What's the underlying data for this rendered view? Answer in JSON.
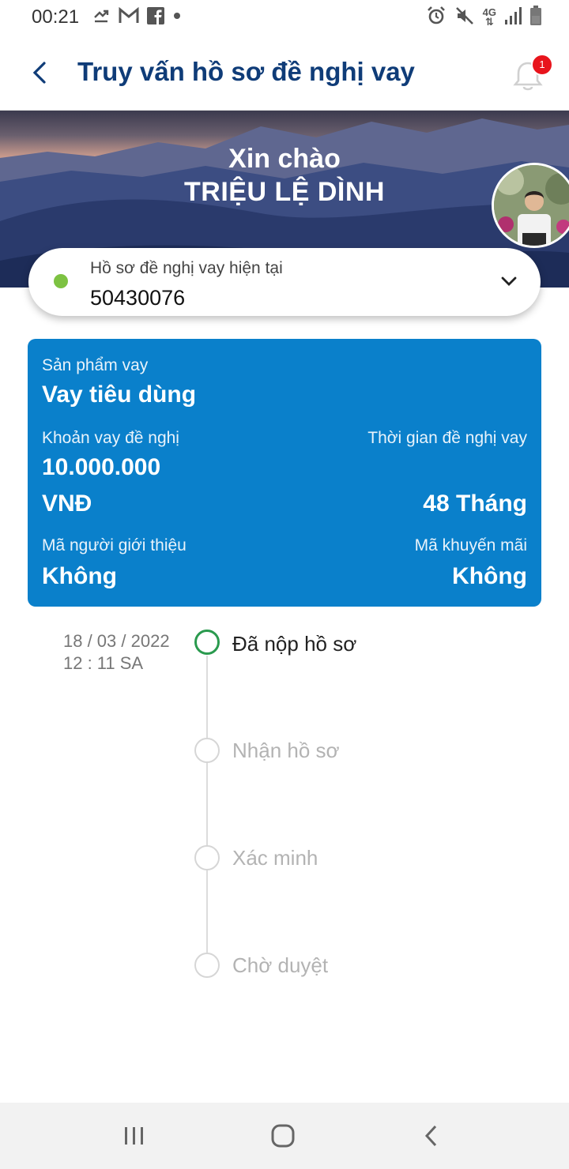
{
  "status_bar": {
    "time": "00:21",
    "network": "4G",
    "left_icons": [
      "data-transfer-icon",
      "gmail-icon",
      "facebook-icon",
      "dot-icon"
    ],
    "right_icons": [
      "alarm-icon",
      "mute-icon",
      "network-4g-icon",
      "signal-icon",
      "battery-icon"
    ]
  },
  "header": {
    "title": "Truy vấn hồ sơ đề nghị vay",
    "notification_count": "1"
  },
  "hero": {
    "greeting": "Xin chào",
    "user_name": "TRIỆU LỆ DÌNH"
  },
  "profile_selector": {
    "label": "Hồ sơ đề nghị vay hiện tại",
    "value": "50430076",
    "status_color": "#7dc242"
  },
  "loan_card": {
    "product_label": "Sản phẩm vay",
    "product_value": "Vay tiêu dùng",
    "amount_label": "Khoản vay đề nghị",
    "amount_value": "10.000.000",
    "currency": "VNĐ",
    "term_label": "Thời gian đề nghị vay",
    "term_value": "48 Tháng",
    "referrer_label": "Mã người giới thiệu",
    "referrer_value": "Không",
    "promo_label": "Mã khuyến mãi",
    "promo_value": "Không",
    "background_color": "#0a80cb"
  },
  "timeline": {
    "date": "18 / 03 / 2022",
    "time": "12 : 11 SA",
    "steps": [
      {
        "label": "Đã nộp hồ sơ",
        "active": true
      },
      {
        "label": "Nhận hồ sơ",
        "active": false
      },
      {
        "label": "Xác minh",
        "active": false
      },
      {
        "label": "Chờ duyệt",
        "active": false
      }
    ],
    "active_color": "#2a9a4e"
  },
  "nav_bar": {
    "buttons": [
      "recent-apps-icon",
      "home-icon",
      "back-icon"
    ]
  }
}
